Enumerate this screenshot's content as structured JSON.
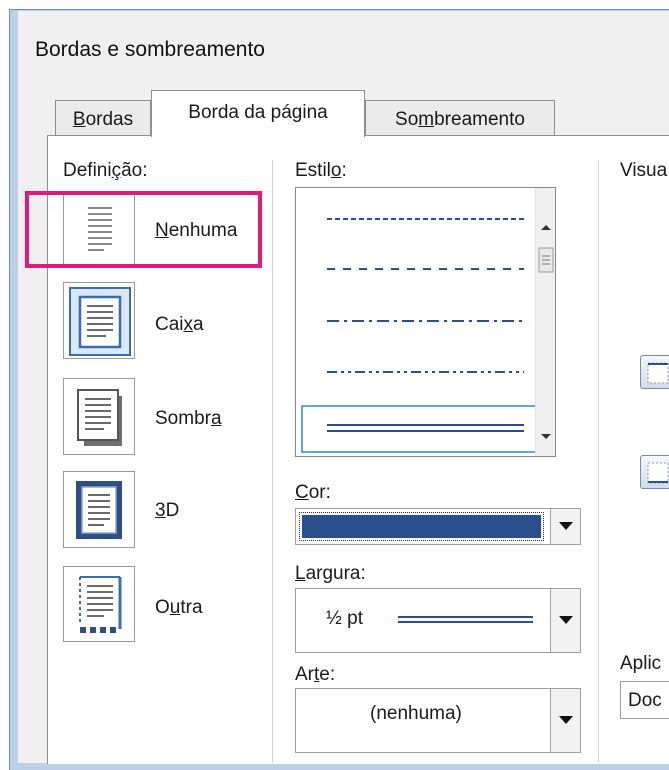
{
  "dialog": {
    "title": "Bordas e sombreamento"
  },
  "tabs": [
    {
      "pre": "",
      "key": "B",
      "post": "ordas"
    },
    {
      "label": "Borda da página"
    },
    {
      "pre": "So",
      "key": "m",
      "post": "breamento"
    }
  ],
  "setting": {
    "heading_pre": "Defini",
    "heading_key": "ç",
    "heading_post": "ão:",
    "selected": "Nenhuma",
    "options": [
      {
        "pre": "",
        "key": "N",
        "post": "enhuma",
        "icon": "page-none-icon"
      },
      {
        "pre": "Cai",
        "key": "x",
        "post": "a",
        "icon": "page-box-icon"
      },
      {
        "pre": "Sombr",
        "key": "a",
        "post": "",
        "icon": "page-shadow-icon"
      },
      {
        "pre": "",
        "key": "3",
        "post": "D",
        "icon": "page-3d-icon"
      },
      {
        "pre": "O",
        "key": "u",
        "post": "tra",
        "icon": "page-custom-icon"
      }
    ]
  },
  "style": {
    "heading_pre": "Estil",
    "heading_key": "o",
    "heading_post": ":",
    "line_styles": [
      "dashed-fine",
      "dashed",
      "dash-dot",
      "dash-dot-dot",
      "double"
    ],
    "selected": "double"
  },
  "color": {
    "label_key": "C",
    "label_post": "or:",
    "value": "#2b4f8e"
  },
  "width": {
    "label_key": "L",
    "label_post": "argura:",
    "value": "½ pt"
  },
  "art": {
    "label_pre": "Ar",
    "label_key": "t",
    "label_post": "e:",
    "value": "(nenhuma)"
  },
  "preview": {
    "heading": "Visua"
  },
  "apply_to": {
    "label": "Aplic",
    "value": "Doc"
  },
  "colors": {
    "accent": "#e3187d",
    "icon_blue": "#3a6db5"
  }
}
